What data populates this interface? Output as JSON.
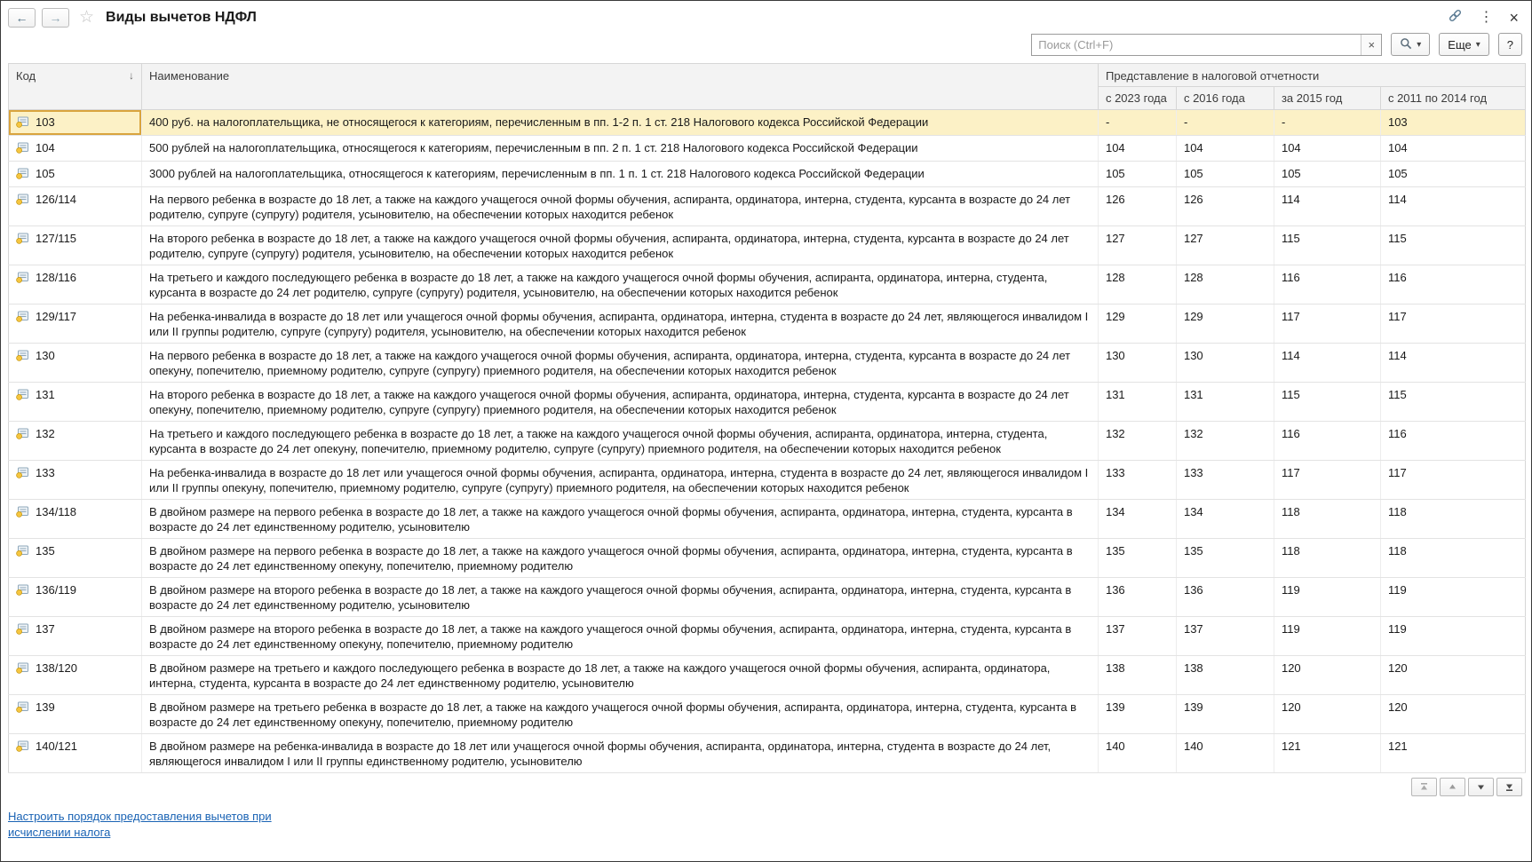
{
  "window": {
    "title": "Виды вычетов НДФЛ"
  },
  "icons": {
    "back": "←",
    "forward": "→",
    "star": "☆",
    "kebab": "⋮",
    "close": "×",
    "clear": "×",
    "dropdown": "▾",
    "sort_desc": "↓",
    "help": "?"
  },
  "toolbar": {
    "search_placeholder": "Поиск (Ctrl+F)",
    "more_label": "Еще",
    "help_label": "?"
  },
  "table": {
    "col_code": "Код",
    "col_name": "Наименование",
    "col_group": "Представление в налоговой отчетности",
    "col_2023": "с 2023 года",
    "col_2016": "с 2016 года",
    "col_2015": "за 2015 год",
    "col_2011_2014": "с 2011 по 2014  год",
    "rows": [
      {
        "selected": true,
        "code": "103",
        "name": "400 руб. на налогоплательщика, не относящегося к категориям, перечисленным в пп. 1-2 п. 1 ст. 218 Налогового кодекса Российской Федерации",
        "v2023": "-",
        "v2016": "-",
        "v2015": "-",
        "v2011_2014": "103"
      },
      {
        "code": "104",
        "name": "500 рублей на налогоплательщика, относящегося к категориям, перечисленным в пп. 2 п. 1 ст. 218 Налогового кодекса Российской Федерации",
        "v2023": "104",
        "v2016": "104",
        "v2015": "104",
        "v2011_2014": "104"
      },
      {
        "code": "105",
        "name": "3000 рублей на налогоплательщика, относящегося к категориям, перечисленным в пп. 1 п. 1 ст. 218 Налогового кодекса Российской Федерации",
        "v2023": "105",
        "v2016": "105",
        "v2015": "105",
        "v2011_2014": "105"
      },
      {
        "code": "126/114",
        "name": "На первого ребенка в возрасте до 18 лет, а также на каждого учащегося очной формы обучения, аспиранта, ординатора, интерна, студента, курсанта в возрасте до 24 лет родителю, супруге (супругу) родителя, усыновителю, на обеспечении которых находится ребенок",
        "v2023": "126",
        "v2016": "126",
        "v2015": "114",
        "v2011_2014": "114"
      },
      {
        "code": "127/115",
        "name": "На второго ребенка в возрасте до 18 лет, а также на каждого учащегося очной формы обучения, аспиранта, ординатора, интерна, студента, курсанта в возрасте до 24 лет родителю, супруге (супругу) родителя, усыновителю, на обеспечении которых находится ребенок",
        "v2023": "127",
        "v2016": "127",
        "v2015": "115",
        "v2011_2014": "115"
      },
      {
        "code": "128/116",
        "name": "На третьего и каждого последующего ребенка в возрасте до 18 лет, а также на каждого учащегося очной формы обучения, аспиранта, ординатора, интерна, студента, курсанта в возрасте до 24 лет родителю, супруге (супругу) родителя, усыновителю, на обеспечении которых находится ребенок",
        "v2023": "128",
        "v2016": "128",
        "v2015": "116",
        "v2011_2014": "116"
      },
      {
        "code": "129/117",
        "name": "На ребенка-инвалида в возрасте до 18 лет или учащегося очной формы обучения, аспиранта, ординатора, интерна, студента в возрасте до 24 лет, являющегося инвалидом I или II группы родителю, супруге (супругу) родителя, усыновителю, на обеспечении которых находится ребенок",
        "v2023": "129",
        "v2016": "129",
        "v2015": "117",
        "v2011_2014": "117"
      },
      {
        "code": "130",
        "name": "На первого ребенка в возрасте до 18 лет, а также на каждого учащегося очной формы обучения, аспиранта, ординатора, интерна, студента, курсанта в возрасте до 24 лет опекуну, попечителю, приемному родителю, супруге (супругу) приемного родителя, на обеспечении которых находится ребенок",
        "v2023": "130",
        "v2016": "130",
        "v2015": "114",
        "v2011_2014": "114"
      },
      {
        "code": "131",
        "name": "На второго ребенка в возрасте до 18 лет, а также на каждого учащегося очной формы обучения, аспиранта, ординатора, интерна, студента, курсанта в возрасте до 24 лет опекуну, попечителю, приемному родителю, супруге (супругу) приемного родителя, на обеспечении которых находится ребенок",
        "v2023": "131",
        "v2016": "131",
        "v2015": "115",
        "v2011_2014": "115"
      },
      {
        "code": "132",
        "name": "На третьего и каждого последующего ребенка в возрасте до 18 лет, а также на каждого учащегося очной формы обучения, аспиранта, ординатора, интерна, студента, курсанта в возрасте до 24 лет опекуну, попечителю, приемному родителю, супруге (супругу) приемного родителя, на обеспечении которых находится ребенок",
        "v2023": "132",
        "v2016": "132",
        "v2015": "116",
        "v2011_2014": "116"
      },
      {
        "code": "133",
        "name": "На ребенка-инвалида в возрасте до 18 лет или учащегося очной формы обучения, аспиранта, ординатора, интерна, студента в возрасте до 24 лет, являющегося инвалидом I или II группы опекуну, попечителю, приемному родителю, супруге (супругу) приемного родителя, на обеспечении которых находится ребенок",
        "v2023": "133",
        "v2016": "133",
        "v2015": "117",
        "v2011_2014": "117"
      },
      {
        "code": "134/118",
        "name": "В двойном размере на первого ребенка в возрасте до 18 лет, а также на каждого учащегося очной формы обучения, аспиранта, ординатора, интерна, студента, курсанта в возрасте до 24 лет единственному родителю, усыновителю",
        "v2023": "134",
        "v2016": "134",
        "v2015": "118",
        "v2011_2014": "118"
      },
      {
        "code": "135",
        "name": "В двойном размере на первого ребенка в возрасте до 18 лет, а также на каждого учащегося очной формы обучения, аспиранта, ординатора, интерна, студента, курсанта в возрасте до 24 лет единственному опекуну, попечителю, приемному родителю",
        "v2023": "135",
        "v2016": "135",
        "v2015": "118",
        "v2011_2014": "118"
      },
      {
        "code": "136/119",
        "name": "В двойном размере на второго ребенка в возрасте до 18 лет, а также на каждого учащегося очной формы обучения, аспиранта, ординатора, интерна, студента, курсанта в возрасте до 24 лет единственному родителю, усыновителю",
        "v2023": "136",
        "v2016": "136",
        "v2015": "119",
        "v2011_2014": "119"
      },
      {
        "code": "137",
        "name": "В двойном размере на второго ребенка в возрасте до 18 лет, а также на каждого учащегося очной формы обучения, аспиранта, ординатора, интерна, студента, курсанта в возрасте до 24 лет единственному опекуну, попечителю, приемному родителю",
        "v2023": "137",
        "v2016": "137",
        "v2015": "119",
        "v2011_2014": "119"
      },
      {
        "code": "138/120",
        "name": "В двойном размере на третьего и каждого последующего ребенка в возрасте до 18 лет, а также на каждого учащегося очной формы обучения, аспиранта, ординатора, интерна, студента, курсанта в возрасте до 24 лет единственному родителю, усыновителю",
        "v2023": "138",
        "v2016": "138",
        "v2015": "120",
        "v2011_2014": "120"
      },
      {
        "code": "139",
        "name": "В двойном размере на третьего ребенка в возрасте до 18 лет, а также на каждого учащегося очной формы обучения, аспиранта, ординатора, интерна, студента, курсанта в возрасте до 24 лет единственному опекуну, попечителю, приемному родителю",
        "v2023": "139",
        "v2016": "139",
        "v2015": "120",
        "v2011_2014": "120"
      },
      {
        "code": "140/121",
        "name": "В двойном размере на ребенка-инвалида в возрасте до 18 лет или учащегося очной формы обучения, аспиранта, ординатора, интерна, студента в возрасте до 24 лет, являющегося инвалидом I или II группы единственному родителю, усыновителю",
        "v2023": "140",
        "v2016": "140",
        "v2015": "121",
        "v2011_2014": "121"
      }
    ]
  },
  "footer": {
    "settings_link": "Настроить порядок предоставления вычетов при исчислении налога"
  }
}
